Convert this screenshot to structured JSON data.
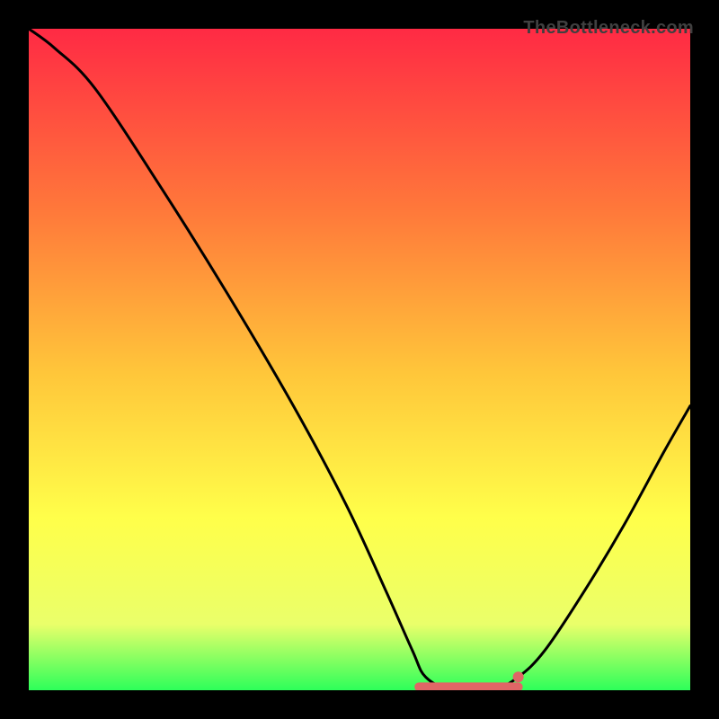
{
  "attribution": "TheBottleneck.com",
  "colors": {
    "frame": "#000000",
    "gradient_top": "#ff2a44",
    "gradient_mid1": "#ff7a3a",
    "gradient_mid2": "#ffc63a",
    "gradient_mid3": "#ffff4a",
    "gradient_mid4": "#eaff6a",
    "gradient_bottom": "#2dff5a",
    "curve": "#000000",
    "marker": "#e06666"
  },
  "chart_data": {
    "type": "line",
    "title": "",
    "xlabel": "",
    "ylabel": "",
    "xlim": [
      0,
      100
    ],
    "ylim": [
      0,
      100
    ],
    "curve": [
      {
        "x": 0,
        "y": 100
      },
      {
        "x": 4,
        "y": 97
      },
      {
        "x": 10,
        "y": 91
      },
      {
        "x": 20,
        "y": 76
      },
      {
        "x": 30,
        "y": 60
      },
      {
        "x": 40,
        "y": 43
      },
      {
        "x": 48,
        "y": 28
      },
      {
        "x": 54,
        "y": 15
      },
      {
        "x": 58,
        "y": 6
      },
      {
        "x": 60,
        "y": 2
      },
      {
        "x": 64,
        "y": 0
      },
      {
        "x": 70,
        "y": 0
      },
      {
        "x": 74,
        "y": 2
      },
      {
        "x": 78,
        "y": 6
      },
      {
        "x": 84,
        "y": 15
      },
      {
        "x": 90,
        "y": 25
      },
      {
        "x": 96,
        "y": 36
      },
      {
        "x": 100,
        "y": 43
      }
    ],
    "marker_range": {
      "x_start": 59,
      "x_end": 74,
      "y": 0.5
    },
    "marker_dot": {
      "x": 74,
      "y": 2
    }
  }
}
